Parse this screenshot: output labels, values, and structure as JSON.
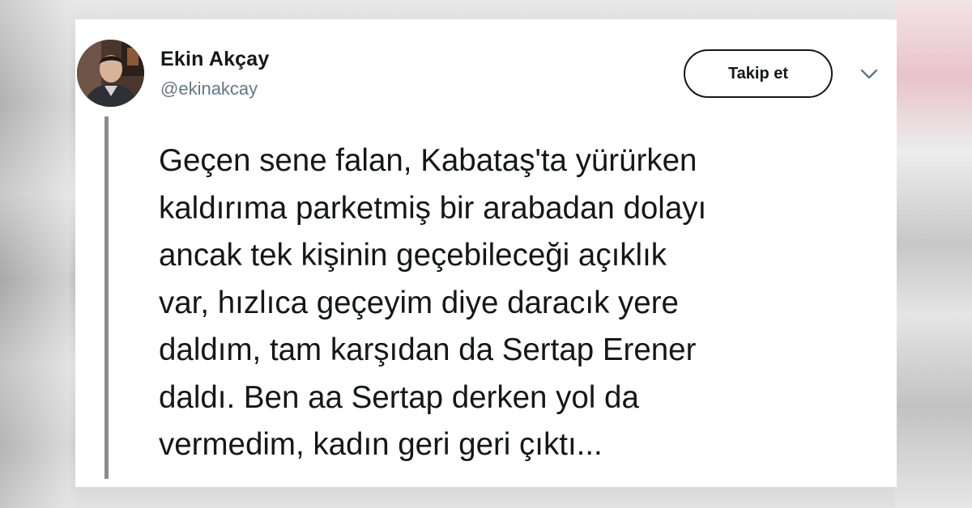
{
  "tweet": {
    "author_name": "Ekin Akçay",
    "author_handle": "@ekinakcay",
    "follow_label": "Takip et",
    "caret_icon": "chevron-down-icon",
    "text_lines": [
      "Geçen sene falan, Kabataş'ta yürürken",
      "kaldırıma parketmiş bir arabadan dolayı",
      "ancak tek kişinin geçebileceği açıklık",
      "var, hızlıca geçeyim diye daracık yere",
      "daldım, tam karşıdan da Sertap Erener",
      "daldı. Ben aa Sertap derken yol da",
      "vermedim, kadın geri geri çıktı..."
    ]
  },
  "colors": {
    "text": "#14171a",
    "handle": "#657786",
    "thread_line": "#8c8c8c",
    "card_background": "#ffffff"
  }
}
